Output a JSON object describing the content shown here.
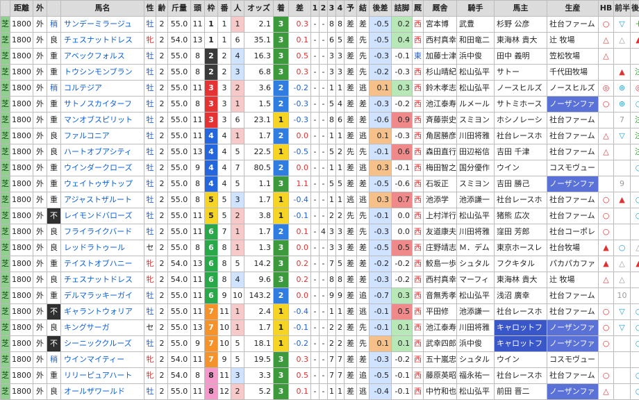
{
  "headers": [
    "",
    "距離",
    "外",
    "",
    "馬名",
    "性",
    "齢",
    "斤量",
    "頭",
    "枠",
    "番",
    "人",
    "オッズ",
    "着",
    "差",
    "1",
    "2",
    "3",
    "4",
    "予",
    "結",
    "後差",
    "詰脚",
    "厩",
    "厩舎",
    "騎手",
    "馬主",
    "生産",
    "HB",
    "前半",
    "後半"
  ],
  "colors": {
    "waku": {
      "1": "#ffffff",
      "2": "#3a3a3a",
      "3": "#e53232",
      "4": "#2566dd",
      "5": "#f5d423",
      "6": "#29a84a",
      "7": "#f5922a",
      "8": "#f39acb"
    },
    "chaku": {
      "1": "#f5d423",
      "2": "#2f7de0",
      "3": "#3c9a3c"
    },
    "ninki_hi": "#f7c9c9",
    "ninki_mid": "#cfe2ff"
  },
  "rows": [
    {
      "s": "芝",
      "d": "1800",
      "io": "外",
      "c": "稍",
      "n": "サンデーミラージュ",
      "sx": "牡",
      "a": "2",
      "w": "55.0",
      "h": "11",
      "wk": "1",
      "b": "1",
      "p": "1",
      "o": "2.1",
      "f": "3",
      "df": "0.3",
      "c1": "-",
      "c2": "-",
      "c3": "8",
      "c4": "8",
      "yo": "差",
      "ke": "差",
      "ld": "-0.5",
      "tz": "0.2",
      "ky": "西",
      "tr": "宮本博",
      "jk": "武豊",
      "ow": "杉野 公彦",
      "br": "社台ファーム",
      "hb": "○",
      "zh": "▽",
      "kh": "＋"
    },
    {
      "s": "芝",
      "d": "1800",
      "io": "外",
      "c": "良",
      "n": "チェスナットドレス",
      "sx": "牝",
      "a": "2",
      "w": "54.0",
      "h": "13",
      "wk": "1",
      "b": "1",
      "p": "6",
      "o": "35.1",
      "f": "3",
      "df": "0.1",
      "c1": "-",
      "c2": "-",
      "c3": "6",
      "c4": "5",
      "yo": "差",
      "ke": "先",
      "ld": "-0.5",
      "tz": "0.4",
      "ky": "西",
      "tr": "西村真幸",
      "jk": "和田竜二",
      "ow": "東海林 貴大",
      "br": "辻 牧場",
      "hb": "△",
      "zh": "△",
      "kh": "▲"
    },
    {
      "s": "芝",
      "d": "1800",
      "io": "外",
      "c": "重",
      "n": "アベックフォルス",
      "sx": "牡",
      "a": "2",
      "w": "55.0",
      "h": "8",
      "wk": "2",
      "b": "2",
      "p": "4",
      "o": "16.3",
      "f": "3",
      "df": "0.5",
      "c1": "-",
      "c2": "-",
      "c3": "3",
      "c4": "3",
      "yo": "差",
      "ke": "先",
      "ld": "-0.3",
      "tz": "-0.1",
      "ky": "東",
      "tr": "加藤士津",
      "jk": "浜中俊",
      "ow": "田中 義明",
      "br": "笠松牧場",
      "hb": "△",
      "zh": "",
      "kh": ""
    },
    {
      "s": "芝",
      "d": "1800",
      "io": "外",
      "c": "重",
      "n": "トウシンモンブラン",
      "sx": "牡",
      "a": "2",
      "w": "55.0",
      "h": "8",
      "wk": "2",
      "b": "2",
      "p": "3",
      "o": "6.8",
      "f": "3",
      "df": "0.3",
      "c1": "-",
      "c2": "-",
      "c3": "3",
      "c4": "3",
      "yo": "差",
      "ke": "先",
      "ld": "-0.2",
      "tz": "-0.3",
      "ky": "西",
      "tr": "杉山晴紀",
      "jk": "松山弘平",
      "ow": "サトー",
      "br": "千代田牧場",
      "hb": "",
      "zh": "▲",
      "kh": "注"
    },
    {
      "s": "芝",
      "d": "1800",
      "io": "外",
      "c": "稍",
      "n": "コルテジア",
      "sx": "牡",
      "a": "2",
      "w": "55.0",
      "h": "11",
      "wk": "3",
      "b": "3",
      "p": "2",
      "o": "3.6",
      "f": "2",
      "df": "-0.2",
      "c1": "-",
      "c2": "-",
      "c3": "1",
      "c4": "1",
      "yo": "差",
      "ke": "逃",
      "ld": "0.1",
      "tz": "0.3",
      "ky": "西",
      "tr": "鈴木孝志",
      "jk": "松山弘平",
      "ow": "ノースヒルズ",
      "br": "ノースヒルズ",
      "hb": "◎",
      "zh": "⊚",
      "kh": "◎"
    },
    {
      "s": "芝",
      "d": "1800",
      "io": "外",
      "c": "重",
      "n": "サトノスカイターフ",
      "sx": "牡",
      "a": "2",
      "w": "55.0",
      "h": "8",
      "wk": "3",
      "b": "3",
      "p": "1",
      "o": "1.5",
      "f": "2",
      "df": "-0.3",
      "c1": "-",
      "c2": "-",
      "c3": "5",
      "c4": "4",
      "yo": "差",
      "ke": "差",
      "ld": "-0.3",
      "tz": "-0.2",
      "ky": "西",
      "tr": "池江泰寿",
      "jk": "ルメール",
      "ow": "サトミホース",
      "br": "ノーザンファ",
      "hb": "○",
      "zh": "⊚",
      "kh": "○"
    },
    {
      "s": "芝",
      "d": "1800",
      "io": "外",
      "c": "重",
      "n": "マンオブスピリット",
      "sx": "牡",
      "a": "2",
      "w": "55.0",
      "h": "11",
      "wk": "3",
      "b": "3",
      "p": "6",
      "o": "23.1",
      "f": "1",
      "df": "-0.3",
      "c1": "-",
      "c2": "-",
      "c3": "8",
      "c4": "6",
      "yo": "差",
      "ke": "差",
      "ld": "-0.6",
      "tz": "0.9",
      "ky": "西",
      "tr": "斉藤崇史",
      "jk": "スミヨン",
      "ow": "ホシノレーシ",
      "br": "社台ファーム",
      "hb": "",
      "zh": "7",
      "kh": "注"
    },
    {
      "s": "芝",
      "d": "1800",
      "io": "外",
      "c": "良",
      "n": "ファルコニア",
      "sx": "牡",
      "a": "2",
      "w": "55.0",
      "h": "11",
      "wk": "4",
      "b": "4",
      "p": "1",
      "o": "1.7",
      "f": "2",
      "df": "0.0",
      "c1": "-",
      "c2": "-",
      "c3": "1",
      "c4": "1",
      "yo": "差",
      "ke": "逃",
      "ld": "0.1",
      "tz": "-0.3",
      "ky": "西",
      "tr": "角居勝彦",
      "jk": "川田将雅",
      "ow": "社台レースホ",
      "br": "社台ファーム",
      "hb": "△",
      "zh": "▽",
      "kh": "注"
    },
    {
      "s": "芝",
      "d": "1800",
      "io": "外",
      "c": "良",
      "n": "ハートオブアシティ",
      "sx": "牡",
      "a": "2",
      "w": "55.0",
      "h": "13",
      "wk": "4",
      "b": "4",
      "p": "5",
      "o": "22.5",
      "f": "1",
      "df": "-0.5",
      "c1": "-",
      "c2": "-",
      "c3": "5",
      "c4": "2",
      "yo": "先",
      "ke": "先",
      "ld": "-0.1",
      "tz": "0.6",
      "ky": "西",
      "tr": "森田直行",
      "jk": "田辺裕信",
      "ow": "吉田 千津",
      "br": "社台ファーム",
      "hb": "△",
      "zh": "",
      "kh": "注"
    },
    {
      "s": "芝",
      "d": "1800",
      "io": "外",
      "c": "重",
      "n": "ウインダークローズ",
      "sx": "牡",
      "a": "2",
      "w": "55.0",
      "h": "9",
      "wk": "4",
      "b": "4",
      "p": "7",
      "o": "80.5",
      "f": "2",
      "df": "0.0",
      "c1": "-",
      "c2": "-",
      "c3": "1",
      "c4": "1",
      "yo": "差",
      "ke": "逃",
      "ld": "0.3",
      "tz": "-0.1",
      "ky": "西",
      "tr": "梅田智之",
      "jk": "国分優作",
      "ow": "ウイン",
      "br": "コスモヴュー",
      "hb": "",
      "zh": "",
      "kh": "○"
    },
    {
      "s": "芝",
      "d": "1800",
      "io": "外",
      "c": "重",
      "n": "ウェイトゥザトップ",
      "sx": "牡",
      "a": "2",
      "w": "55.0",
      "h": "8",
      "wk": "4",
      "b": "4",
      "p": "5",
      "o": "1.1",
      "f": "3",
      "df": "1.1",
      "c1": "-",
      "c2": "-",
      "c3": "5",
      "c4": "5",
      "yo": "差",
      "ke": "差",
      "ld": "-0.5",
      "tz": "-0.6",
      "ky": "西",
      "tr": "石坂正",
      "jk": "スミヨン",
      "ow": "吉田 勝己",
      "br": "ノーザンファ",
      "hb": "",
      "zh": "9",
      "kh": ""
    },
    {
      "s": "芝",
      "d": "1800",
      "io": "外",
      "c": "重",
      "n": "アジャストザルート",
      "sx": "牡",
      "a": "2",
      "w": "55.0",
      "h": "8",
      "wk": "5",
      "b": "5",
      "p": "3",
      "o": "1.7",
      "f": "1",
      "df": "-0.4",
      "c1": "-",
      "c2": "-",
      "c3": "1",
      "c4": "1",
      "yo": "逃",
      "ke": "逃",
      "ld": "0.3",
      "tz": "0.7",
      "ky": "西",
      "tr": "池添学",
      "jk": "池添謙一",
      "ow": "社台レースホ",
      "br": "社台ファーム",
      "hb": "○",
      "zh": "▲",
      "kh": "○"
    },
    {
      "s": "芝",
      "d": "1800",
      "io": "外",
      "c": "不",
      "n": "レイモンドバローズ",
      "sx": "牡",
      "a": "2",
      "w": "55.0",
      "h": "11",
      "wk": "5",
      "b": "5",
      "p": "2",
      "o": "3.8",
      "f": "1",
      "df": "-0.1",
      "c1": "-",
      "c2": "-",
      "c3": "2",
      "c4": "2",
      "yo": "先",
      "ke": "先",
      "ld": "-0.1",
      "tz": "0.0",
      "ky": "西",
      "tr": "上村洋行",
      "jk": "松山弘平",
      "ow": "猪熊 広次",
      "br": "社台ファーム",
      "hb": "○",
      "zh": "",
      "kh": "○"
    },
    {
      "s": "芝",
      "d": "1800",
      "io": "外",
      "c": "良",
      "n": "フライライクバード",
      "sx": "牡",
      "a": "2",
      "w": "55.0",
      "h": "11",
      "wk": "6",
      "b": "7",
      "p": "1",
      "o": "1.7",
      "f": "2",
      "df": "0.1",
      "c1": "-",
      "c2": "4",
      "c3": "3",
      "c4": "3",
      "yo": "差",
      "ke": "先",
      "ld": "-0.3",
      "tz": "0.0",
      "ky": "西",
      "tr": "友道康夫",
      "jk": "川田将雅",
      "ow": "窪田 芳郎",
      "br": "社台コーポレ",
      "hb": "○",
      "zh": "",
      "kh": ""
    },
    {
      "s": "芝",
      "d": "1800",
      "io": "外",
      "c": "良",
      "n": "レッドラトゥール",
      "sx": "セ",
      "a": "2",
      "w": "55.0",
      "h": "8",
      "wk": "6",
      "b": "8",
      "p": "1",
      "o": "1.3",
      "f": "3",
      "df": "0.0",
      "c1": "-",
      "c2": "-",
      "c3": "3",
      "c4": "3",
      "yo": "差",
      "ke": "差",
      "ld": "-0.5",
      "tz": "0.5",
      "ky": "西",
      "tr": "庄野靖志",
      "jk": "Ｍ．デム",
      "ow": "東京ホースレ",
      "br": "社台牧場",
      "hb": "▲",
      "zh": "○",
      "kh": "△"
    },
    {
      "s": "芝",
      "d": "1800",
      "io": "外",
      "c": "重",
      "n": "テイストオブハニー",
      "sx": "牝",
      "a": "2",
      "w": "54.0",
      "h": "13",
      "wk": "6",
      "b": "8",
      "p": "5",
      "o": "14.2",
      "f": "3",
      "df": "0.2",
      "c1": "-",
      "c2": "-",
      "c3": "7",
      "c4": "5",
      "yo": "差",
      "ke": "差",
      "ld": "-0.2",
      "tz": "-0.2",
      "ky": "西",
      "tr": "鮫島一歩",
      "jk": "シュタル",
      "ow": "フクキタル",
      "br": "パカパカファ",
      "hb": "▲",
      "zh": "△",
      "kh": "▲"
    },
    {
      "s": "芝",
      "d": "1800",
      "io": "外",
      "c": "良",
      "n": "チェスナットドレス",
      "sx": "牝",
      "a": "2",
      "w": "54.0",
      "h": "11",
      "wk": "6",
      "b": "8",
      "p": "4",
      "o": "9.6",
      "f": "3",
      "df": "0.2",
      "c1": "-",
      "c2": "-",
      "c3": "8",
      "c4": "8",
      "yo": "差",
      "ke": "差",
      "ld": "-0.3",
      "tz": "-0.2",
      "ky": "西",
      "tr": "西村真幸",
      "jk": "マーフィ",
      "ow": "東海林 貴大",
      "br": "辻 牧場",
      "hb": "△",
      "zh": "△",
      "kh": ""
    },
    {
      "s": "芝",
      "d": "1800",
      "io": "外",
      "c": "重",
      "n": "デルマラッキーガイ",
      "sx": "牡",
      "a": "2",
      "w": "55.0",
      "h": "11",
      "wk": "6",
      "b": "9",
      "p": "10",
      "o": "143.2",
      "f": "2",
      "df": "0.0",
      "c1": "-",
      "c2": "-",
      "c3": "9",
      "c4": "9",
      "yo": "差",
      "ke": "追",
      "ld": "-0.7",
      "tz": "0.3",
      "ky": "西",
      "tr": "音無秀孝",
      "jk": "松山弘平",
      "ow": "浅沼 廣幸",
      "br": "社台ファーム",
      "hb": "",
      "zh": "10",
      "kh": ""
    },
    {
      "s": "芝",
      "d": "1800",
      "io": "外",
      "c": "不",
      "n": "ギャラントウォリア",
      "sx": "牡",
      "a": "2",
      "w": "55.0",
      "h": "11",
      "wk": "7",
      "b": "11",
      "p": "1",
      "o": "2.4",
      "f": "1",
      "df": "-0.4",
      "c1": "-",
      "c2": "-",
      "c3": "1",
      "c4": "1",
      "yo": "差",
      "ke": "逃",
      "ld": "-0.1",
      "tz": "0.5",
      "ky": "西",
      "tr": "平田修",
      "jk": "池添謙一",
      "ow": "社台レースホ",
      "br": "社台ファーム",
      "hb": "○",
      "zh": "▽",
      "kh": "○"
    },
    {
      "s": "芝",
      "d": "1800",
      "io": "外",
      "c": "良",
      "n": "キングサーガ",
      "sx": "セ",
      "a": "2",
      "w": "55.0",
      "h": "13",
      "wk": "7",
      "b": "10",
      "p": "1",
      "o": "1.7",
      "f": "1",
      "df": "-0.1",
      "c1": "-",
      "c2": "-",
      "c3": "2",
      "c4": "2",
      "yo": "差",
      "ke": "先",
      "ld": "-0.1",
      "tz": "0.1",
      "ky": "西",
      "tr": "池江泰寿",
      "jk": "川田将雅",
      "ow": "キャロットフ",
      "br": "ノーザンファ",
      "hb": "○",
      "zh": "▽",
      "kh": "○"
    },
    {
      "s": "芝",
      "d": "1800",
      "io": "外",
      "c": "不",
      "n": "シーニッククルーズ",
      "sx": "牡",
      "a": "2",
      "w": "55.0",
      "h": "9",
      "wk": "7",
      "b": "10",
      "p": "5",
      "o": "18.1",
      "f": "1",
      "df": "-0.2",
      "c1": "-",
      "c2": "-",
      "c3": "2",
      "c4": "2",
      "yo": "差",
      "ke": "先",
      "ld": "0.1",
      "tz": "0.1",
      "ky": "西",
      "tr": "武幸四郎",
      "jk": "浜中俊",
      "ow": "キャロットフ",
      "br": "ノーザンファ",
      "hb": "○",
      "zh": "",
      "kh": "○"
    },
    {
      "s": "芝",
      "d": "1800",
      "io": "外",
      "c": "稍",
      "n": "ウインマイティー",
      "sx": "牝",
      "a": "2",
      "w": "54.0",
      "h": "11",
      "wk": "7",
      "b": "9",
      "p": "5",
      "o": "19.5",
      "f": "3",
      "df": "0.3",
      "c1": "-",
      "c2": "-",
      "c3": "7",
      "c4": "7",
      "yo": "差",
      "ke": "差",
      "ld": "-0.3",
      "tz": "-0.2",
      "ky": "西",
      "tr": "五十嵐忠",
      "jk": "シュタル",
      "ow": "ウイン",
      "br": "コスモヴュー",
      "hb": "",
      "zh": "",
      "kh": ""
    },
    {
      "s": "芝",
      "d": "1800",
      "io": "外",
      "c": "重",
      "n": "リリーピュアハート",
      "sx": "牝",
      "a": "2",
      "w": "54.0",
      "h": "8",
      "wk": "8",
      "b": "11",
      "p": "3",
      "o": "3.3",
      "f": "3",
      "df": "0.5",
      "c1": "-",
      "c2": "-",
      "c3": "7",
      "c4": "7",
      "yo": "差",
      "ke": "追",
      "ld": "-0.5",
      "tz": "-0.1",
      "ky": "西",
      "tr": "藤原英昭",
      "jk": "福永祐一",
      "ow": "社台レースホ",
      "br": "社台ファーム",
      "hb": "○",
      "zh": "",
      "kh": "○"
    },
    {
      "s": "芝",
      "d": "1800",
      "io": "外",
      "c": "良",
      "n": "オールザワールド",
      "sx": "牡",
      "a": "2",
      "w": "55.0",
      "h": "11",
      "wk": "8",
      "b": "12",
      "p": "2",
      "o": "5.2",
      "f": "3",
      "df": "0.1",
      "c1": "-",
      "c2": "-",
      "c3": "1",
      "c4": "1",
      "yo": "差",
      "ke": "逃",
      "ld": "-0.4",
      "tz": "-0.1",
      "ky": "西",
      "tr": "中竹和也",
      "jk": "松山弘平",
      "ow": "前田 晋二",
      "br": "ノーザンファ",
      "hb": "△",
      "zh": "",
      "kh": "○"
    }
  ]
}
